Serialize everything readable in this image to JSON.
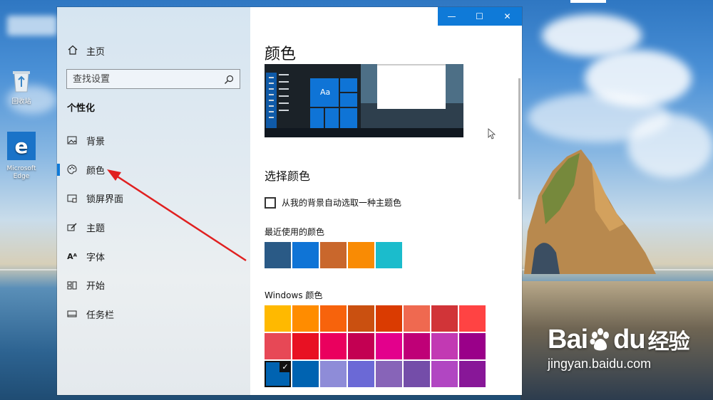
{
  "desktop": {
    "icons": [
      {
        "label": "回收站"
      },
      {
        "label": "Microsoft Edge"
      }
    ]
  },
  "window": {
    "controls": {
      "minimize": "—",
      "maximize": "☐",
      "close": "✕"
    }
  },
  "sidebar": {
    "home_label": "主页",
    "search_placeholder": "查找设置",
    "section_title": "个性化",
    "items": [
      {
        "label": "背景",
        "icon": "picture-icon"
      },
      {
        "label": "颜色",
        "icon": "palette-icon",
        "active": true
      },
      {
        "label": "锁屏界面",
        "icon": "lock-screen-icon"
      },
      {
        "label": "主题",
        "icon": "brush-icon"
      },
      {
        "label": "字体",
        "icon": "font-icon"
      },
      {
        "label": "开始",
        "icon": "start-icon"
      },
      {
        "label": "任务栏",
        "icon": "taskbar-icon"
      }
    ]
  },
  "content": {
    "title": "颜色",
    "preview_tile_text": "Aa",
    "choose_color_heading": "选择颜色",
    "auto_pick_label": "从我的背景自动选取一种主题色",
    "auto_pick_checked": false,
    "recent_colors_label": "最近使用的颜色",
    "recent_colors": [
      "#2a5a86",
      "#0f74d6",
      "#c9672c",
      "#f98b04",
      "#1bbccc"
    ],
    "windows_colors_label": "Windows 颜色",
    "windows_colors": [
      "#ffb900",
      "#ff8c00",
      "#f7630c",
      "#ca5010",
      "#da3b01",
      "#ef6950",
      "#d13438",
      "#ff4343",
      "#e74856",
      "#e81123",
      "#ea005e",
      "#c30052",
      "#e3008c",
      "#bf0077",
      "#c239b3",
      "#9a0089",
      "#0063b1",
      "#0063b1",
      "#8e8cd8",
      "#6b69d6",
      "#8764b8",
      "#744da9",
      "#b146c2",
      "#881798"
    ],
    "selected_color_index": 16,
    "accent_color": "#0f7ad8"
  },
  "watermark": {
    "brand": "Bai",
    "brand_suffix": "du",
    "brand_cn": "经验",
    "url": "jingyan.baidu.com"
  }
}
